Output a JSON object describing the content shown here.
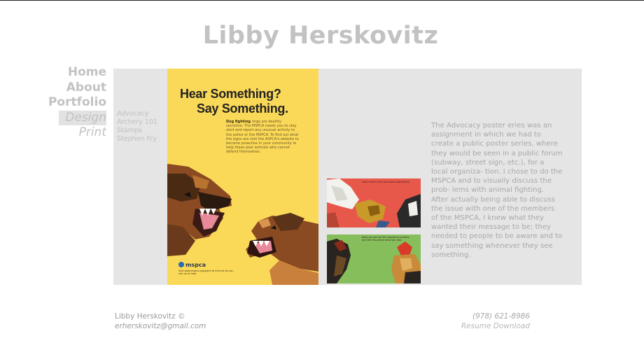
{
  "site": {
    "title": "Libby Herskovitz"
  },
  "nav": {
    "items": [
      {
        "label": "Home"
      },
      {
        "label": "About"
      },
      {
        "label": "Portfolio"
      },
      {
        "label": "Design"
      },
      {
        "label": "Print"
      }
    ]
  },
  "subnav": {
    "items": [
      {
        "label": "Advocacy"
      },
      {
        "label": "Archery 101"
      },
      {
        "label": "Stamps"
      },
      {
        "label": "Stephen Fry"
      }
    ]
  },
  "poster": {
    "headline_1": "Hear Something?",
    "headline_2": "Say Something.",
    "body_bold": "Dog fighting",
    "body_text": "rings are deathly secretive. The MSPCA needs you to stay alert and report any unusual activity to the police or the MSPCA. To find out what the signs are visit the ASPCA's website to become proactive in your community to help these poor animals who cannot defend themselves.",
    "logo_text": "mspca",
    "fine_print": "Visit www.mspca.org/signs to find out all you can do to help.",
    "background": "#fbd958"
  },
  "thumbnails": {
    "thumb1_caption": "Learn more from your local authorities.",
    "thumb2_caption": "Keep an eye out for suspicious activity and tell the police what you see."
  },
  "description": "The Advocacy poster eries was an assignment in which we had to create a public poster series, where they would be seen in a public forum (subway, street sign, etc.), for a local organiza- tion. I chose to do the MSPCA and to visually discuss the prob- lems with animal fighting. After actually being able to discuss the issue with one of the members of the MSPCA, I knew what they wanted their message to be; they needed to people to be aware and to say something whenever they see something.",
  "footer": {
    "name": "Libby Herskovitz ©",
    "email": "erherskovitz@gmail.com",
    "phone": "(978) 621-8986",
    "resume_label": "Resume Download"
  },
  "colors": {
    "panel": "#e4e5e4",
    "muted_text": "#c2c2c2",
    "poster_yellow": "#fbd958"
  }
}
